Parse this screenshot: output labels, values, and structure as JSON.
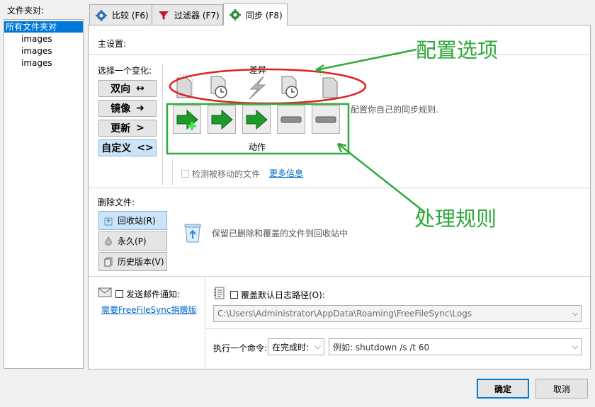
{
  "folders": {
    "label": "文件夹对:",
    "root": "所有文件夹对",
    "items": [
      "images",
      "images",
      "images"
    ]
  },
  "tabs": [
    {
      "label": "比较 (F6)"
    },
    {
      "label": "过滤器 (F7)"
    },
    {
      "label": "同步 (F8)"
    }
  ],
  "main_settings_label": "主设置:",
  "variant": {
    "label": "选择一个变化:",
    "buttons": [
      {
        "label": "双向",
        "symbol": "↔"
      },
      {
        "label": "镜像",
        "symbol": "➜"
      },
      {
        "label": "更新",
        "symbol": ">"
      },
      {
        "label": "自定义",
        "symbol": "<>"
      }
    ],
    "selected": "自定义"
  },
  "differences_label": "差异",
  "actions_label": "动作",
  "config_hint": "配置你自己的同步规则.",
  "detect_moved": {
    "label": "检测被移动的文件",
    "checked": false,
    "more_info": "更多信息"
  },
  "delete": {
    "label": "删除文件:",
    "options": [
      {
        "label": "回收站(R)",
        "icon": "recycle-bin-icon"
      },
      {
        "label": "永久(P)",
        "icon": "flame-icon"
      },
      {
        "label": "历史版本(V)",
        "icon": "versioning-icon"
      }
    ],
    "selected": "回收站(R)",
    "description": "保留已删除和覆盖的文件到回收站中"
  },
  "email": {
    "label": "发送邮件通知:",
    "checked": false,
    "donation_link": "需要FreeFileSync捐赠版"
  },
  "log": {
    "label": "覆盖默认日志路径(O):",
    "checked": false,
    "path": "C:\\Users\\Administrator\\AppData\\Roaming\\FreeFileSync\\Logs"
  },
  "command": {
    "label": "执行一个命令:",
    "when": "在完成时:",
    "placeholder": "例如: shutdown /s /t 60"
  },
  "footer": {
    "ok": "确定",
    "cancel": "取消"
  },
  "annotations": {
    "config_options": "配置选项",
    "handling_rules": "处理规则",
    "color": "#2eaa3a",
    "ellipse_color": "#e02020"
  }
}
